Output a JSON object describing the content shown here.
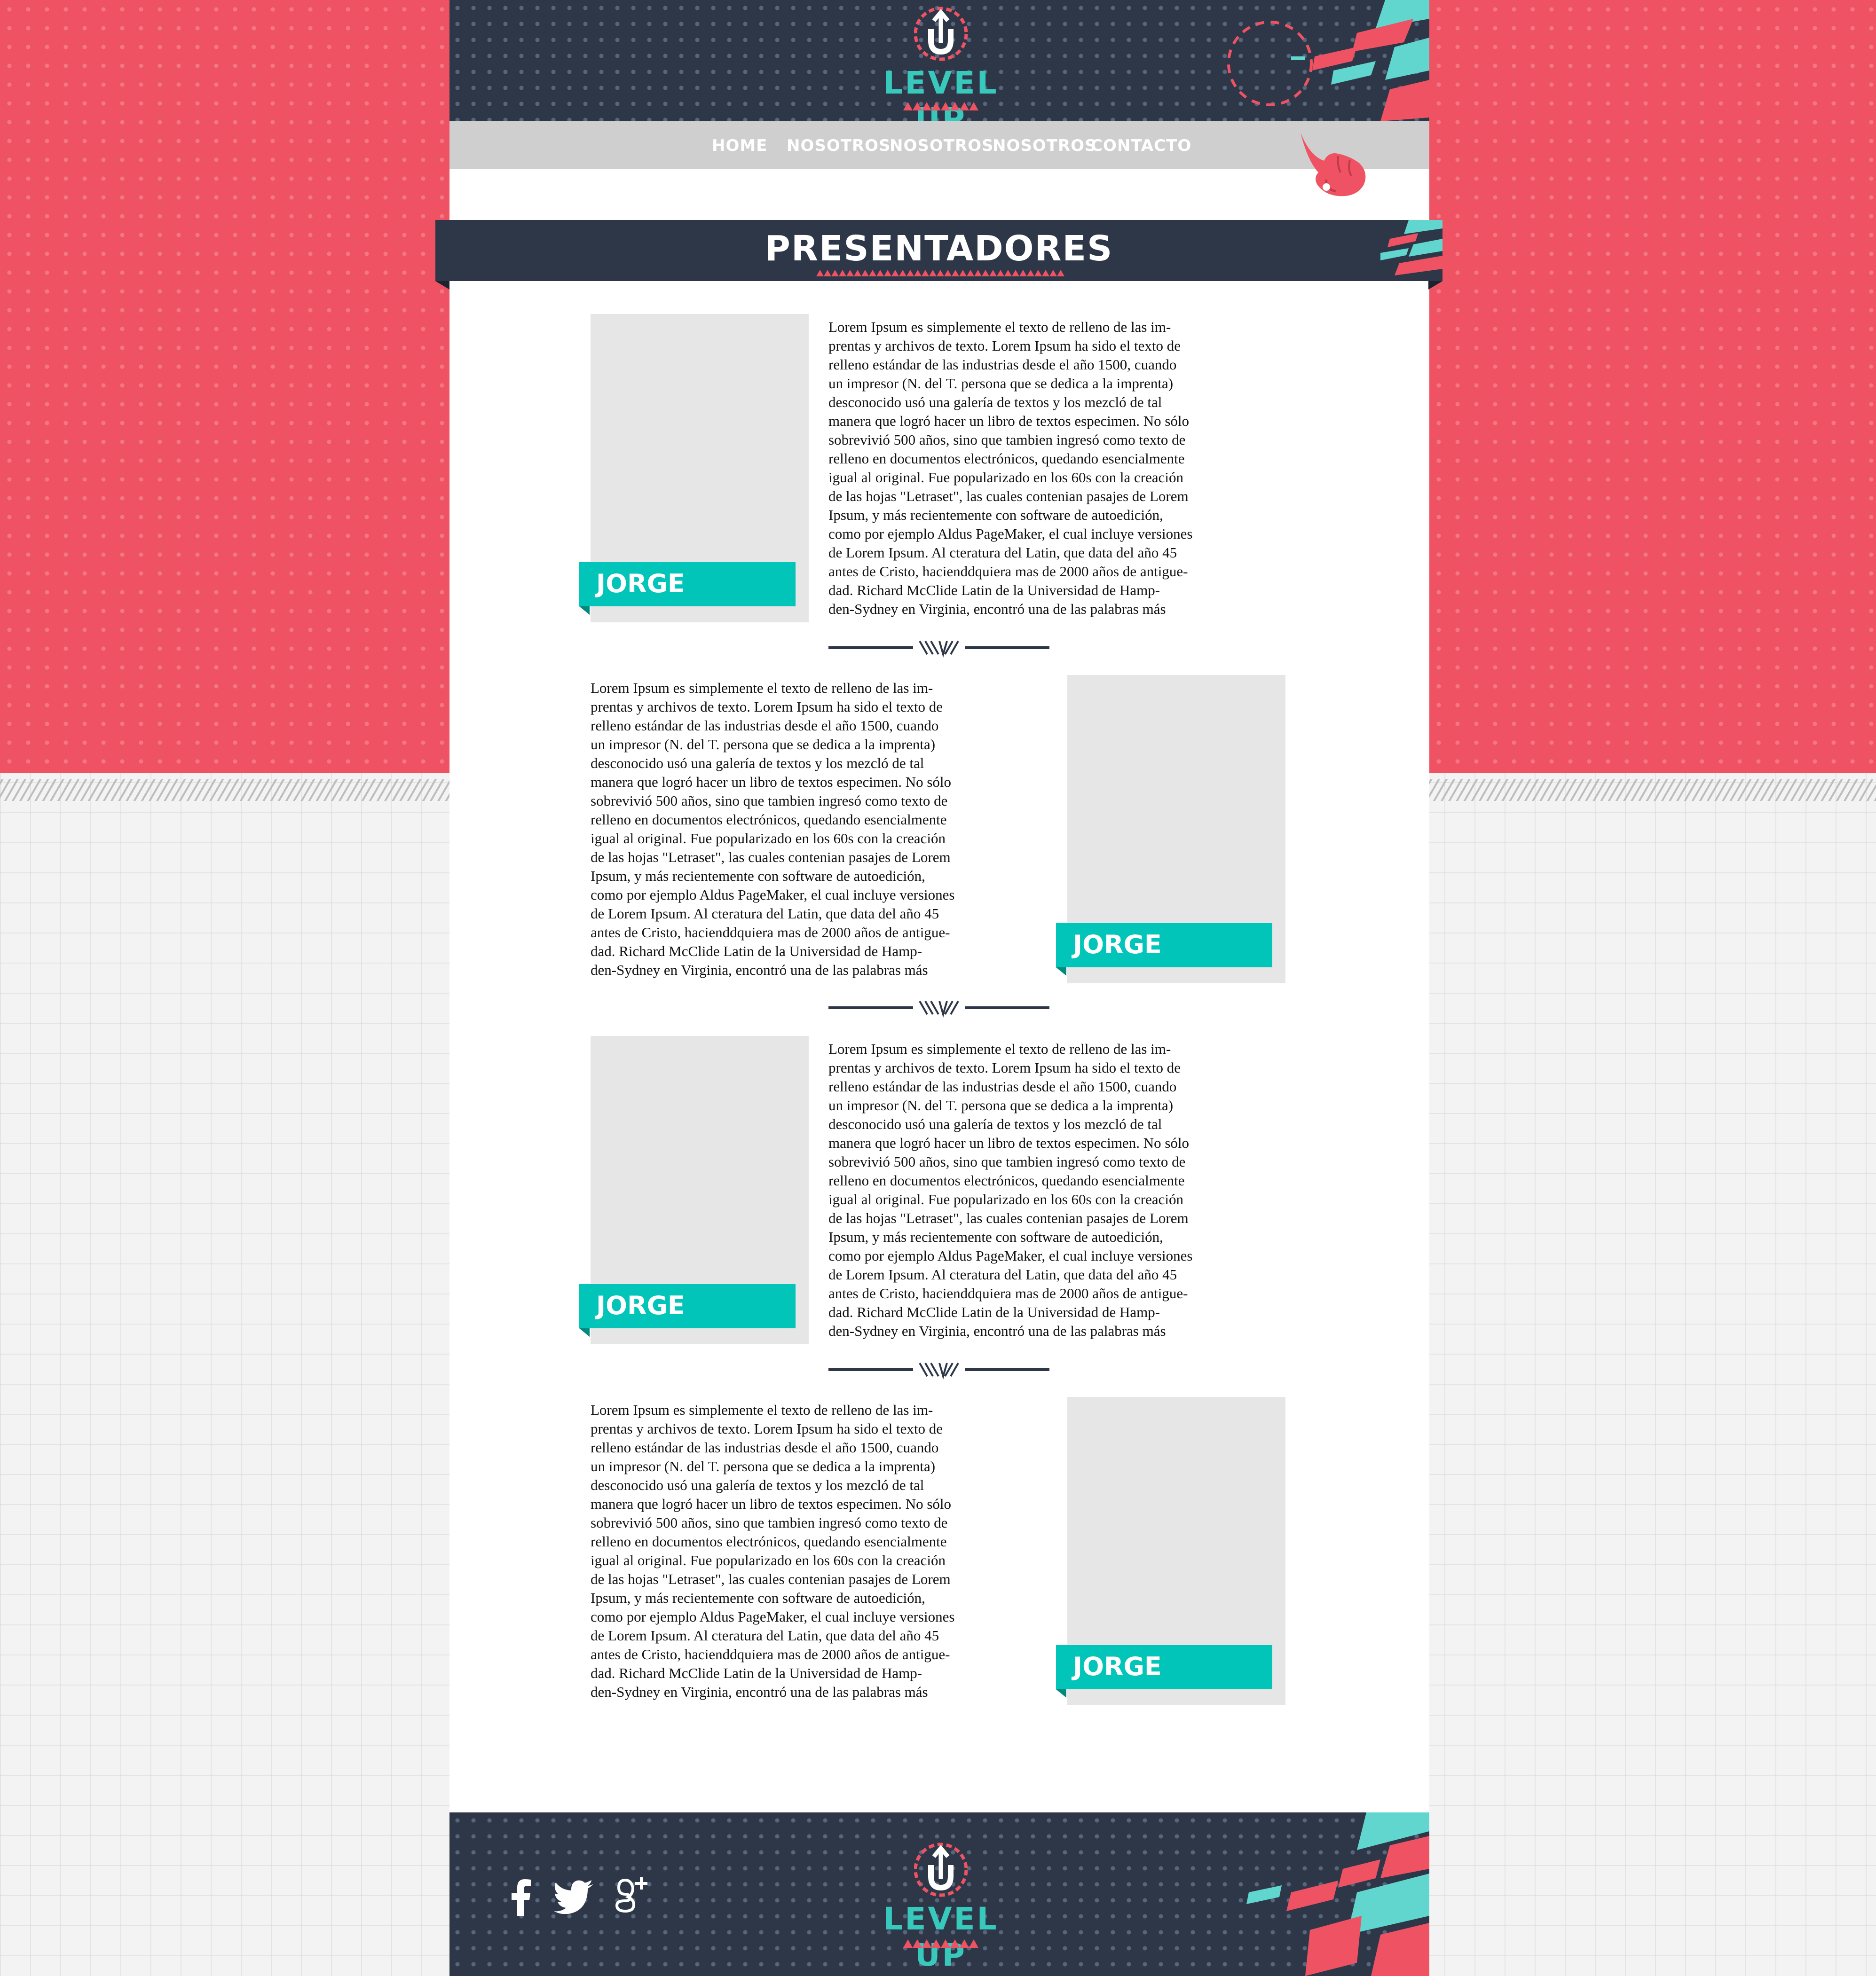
{
  "colors": {
    "brand_red": "#ef5263",
    "navy": "#2e3748",
    "teal": "#00c5b8",
    "nav_gray": "#cfcfcf",
    "photo_placeholder": "#e6e6e6"
  },
  "header": {
    "logo_text": "LEVEL UP",
    "logo_letter": "U"
  },
  "nav": {
    "items": [
      {
        "label": "HOME"
      },
      {
        "label": "NOSOTROS"
      },
      {
        "label": "NOSOTROS"
      },
      {
        "label": "NOSOTROS"
      },
      {
        "label": "CONTACTO"
      }
    ],
    "pointer_icon": "hand-pointer-icon"
  },
  "main": {
    "title": "PRESENTADORES",
    "divider_glyph": "\\\\\\V//",
    "presenters": [
      {
        "name": "JORGE",
        "bio": "Lorem Ipsum es simplemente el texto de relleno de las im-\nprentas y archivos de texto. Lorem Ipsum ha sido el texto de\nrelleno estándar de las industrias desde el año 1500, cuando\nun impresor (N. del T. persona que se dedica a la imprenta)\ndesconocido usó una galería de textos y los mezcló de tal\nmanera que logró hacer un libro de textos especimen. No sólo\nsobrevivió 500 años, sino que tambien ingresó como texto de\nrelleno en documentos electrónicos, quedando esencialmente\nigual al original. Fue popularizado en los 60s con la creación\nde las hojas \"Letraset\", las cuales contenian pasajes de Lorem\nIpsum, y más recientemente con software de autoedición,\ncomo por ejemplo Aldus PageMaker, el cual incluye versiones\nde Lorem Ipsum. Al cteratura del Latin, que data del año 45\nantes de Cristo, hacienddquiera mas de 2000 años de antigue-\ndad. Richard McClide Latin de la Universidad de Hamp-\nden-Sydney en Virginia, encontró una de las palabras más"
      },
      {
        "name": "JORGE",
        "bio": "Lorem Ipsum es simplemente el texto de relleno de las im-\nprentas y archivos de texto. Lorem Ipsum ha sido el texto de\nrelleno estándar de las industrias desde el año 1500, cuando\nun impresor (N. del T. persona que se dedica a la imprenta)\ndesconocido usó una galería de textos y los mezcló de tal\nmanera que logró hacer un libro de textos especimen. No sólo\nsobrevivió 500 años, sino que tambien ingresó como texto de\nrelleno en documentos electrónicos, quedando esencialmente\nigual al original. Fue popularizado en los 60s con la creación\nde las hojas \"Letraset\", las cuales contenian pasajes de Lorem\nIpsum, y más recientemente con software de autoedición,\ncomo por ejemplo Aldus PageMaker, el cual incluye versiones\nde Lorem Ipsum. Al cteratura del Latin, que data del año 45\nantes de Cristo, hacienddquiera mas de 2000 años de antigue-\ndad. Richard McClide Latin de la Universidad de Hamp-\nden-Sydney en Virginia, encontró una de las palabras más"
      },
      {
        "name": "JORGE",
        "bio": "Lorem Ipsum es simplemente el texto de relleno de las im-\nprentas y archivos de texto. Lorem Ipsum ha sido el texto de\nrelleno estándar de las industrias desde el año 1500, cuando\nun impresor (N. del T. persona que se dedica a la imprenta)\ndesconocido usó una galería de textos y los mezcló de tal\nmanera que logró hacer un libro de textos especimen. No sólo\nsobrevivió 500 años, sino que tambien ingresó como texto de\nrelleno en documentos electrónicos, quedando esencialmente\nigual al original. Fue popularizado en los 60s con la creación\nde las hojas \"Letraset\", las cuales contenian pasajes de Lorem\nIpsum, y más recientemente con software de autoedición,\ncomo por ejemplo Aldus PageMaker, el cual incluye versiones\nde Lorem Ipsum. Al cteratura del Latin, que data del año 45\nantes de Cristo, hacienddquiera mas de 2000 años de antigue-\ndad. Richard McClide Latin de la Universidad de Hamp-\nden-Sydney en Virginia, encontró una de las palabras más"
      },
      {
        "name": "JORGE",
        "bio": "Lorem Ipsum es simplemente el texto de relleno de las im-\nprentas y archivos de texto. Lorem Ipsum ha sido el texto de\nrelleno estándar de las industrias desde el año 1500, cuando\nun impresor (N. del T. persona que se dedica a la imprenta)\ndesconocido usó una galería de textos y los mezcló de tal\nmanera que logró hacer un libro de textos especimen. No sólo\nsobrevivió 500 años, sino que tambien ingresó como texto de\nrelleno en documentos electrónicos, quedando esencialmente\nigual al original. Fue popularizado en los 60s con la creación\nde las hojas \"Letraset\", las cuales contenian pasajes de Lorem\nIpsum, y más recientemente con software de autoedición,\ncomo por ejemplo Aldus PageMaker, el cual incluye versiones\nde Lorem Ipsum. Al cteratura del Latin, que data del año 45\nantes de Cristo, hacienddquiera mas de 2000 años de antigue-\ndad. Richard McClide Latin de la Universidad de Hamp-\nden-Sydney en Virginia, encontró una de las palabras más"
      }
    ]
  },
  "footer": {
    "logo_text": "LEVEL UP",
    "logo_letter": "U",
    "social": [
      {
        "icon": "facebook-icon",
        "glyph": "f"
      },
      {
        "icon": "twitter-icon",
        "glyph": ""
      },
      {
        "icon": "google-plus-icon",
        "glyph": "g+"
      }
    ]
  }
}
